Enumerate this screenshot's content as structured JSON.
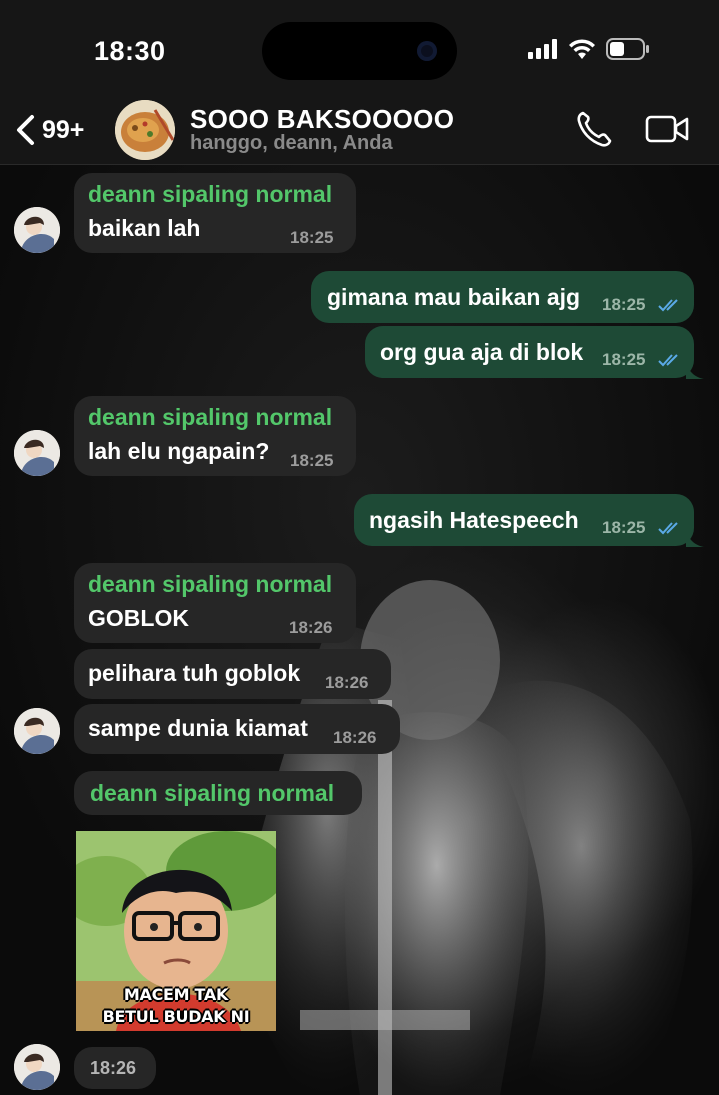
{
  "status_bar": {
    "time": "18:30"
  },
  "header": {
    "back_count": "99+",
    "title": "SOOO BAKSOOOOO",
    "members": "hanggo, deann, Anda"
  },
  "messages": [
    {
      "sender": "deann sipaling normal",
      "text": "baikan lah",
      "time": "18:25",
      "direction": "in"
    },
    {
      "text": "gimana mau baikan ajg",
      "time": "18:25",
      "direction": "out",
      "status": "read"
    },
    {
      "text": "org gua aja di blok",
      "time": "18:25",
      "direction": "out",
      "status": "read"
    },
    {
      "sender": "deann sipaling normal",
      "text": "lah elu ngapain?",
      "time": "18:25",
      "direction": "in"
    },
    {
      "text": "ngasih Hatespeech",
      "time": "18:25",
      "direction": "out",
      "status": "read"
    },
    {
      "sender": "deann sipaling normal",
      "text": "GOBLOK",
      "time": "18:26",
      "direction": "in"
    },
    {
      "text": "pelihara tuh goblok",
      "time": "18:26",
      "direction": "in"
    },
    {
      "text": "sampe dunia kiamat",
      "time": "18:26",
      "direction": "in"
    },
    {
      "sender": "deann sipaling normal",
      "direction": "in",
      "type": "sticker",
      "sticker_caption_1": "MACEM TAK",
      "sticker_caption_2": "BETUL BUDAK NI",
      "time": "18:26"
    }
  ],
  "colors": {
    "incoming_bubble": "#262626",
    "outgoing_bubble": "#1e4a36",
    "sender_name": "#53c76a",
    "read_ticks": "#5aa9e6"
  }
}
